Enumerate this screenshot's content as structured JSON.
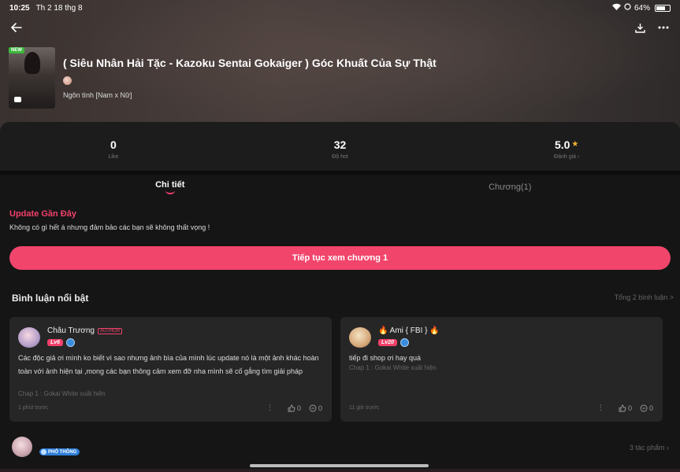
{
  "status_bar": {
    "time": "10:25",
    "date": "Th 2 18 thg 8",
    "battery": "64%"
  },
  "story": {
    "badge": "NEW",
    "title": "( Siêu Nhân Hải Tặc - Kazoku Sentai Gokaiger ) Góc Khuất Của Sự Thật",
    "genre": "Ngôn tình [Nam x Nữ]"
  },
  "stats": {
    "likes_value": "0",
    "likes_label": "Like",
    "hot_value": "32",
    "hot_label": "Độ hot",
    "rating_value": "5.0",
    "rating_label": "Đánh giá ›"
  },
  "tabs": {
    "detail": "Chi tiết",
    "chapters": "Chương(1)"
  },
  "update": {
    "title": "Update Gần Đây",
    "text": "Không có gì hết á nhưng đảm bảo các bạn sẽ không thất vọng !"
  },
  "continue_button": "Tiếp tục xem chương 1",
  "comments": {
    "header": "Bình luận nổi bật",
    "total": "Tổng 2 bình luận >",
    "items": [
      {
        "name": "Châu Trương",
        "author_tag": "AUTHOR",
        "level": "Lv6",
        "text": "Các độc giả ơi mình ko biết vì sao nhưng ảnh bìa của mình lúc update nó là một ảnh khác hoàn toàn với ảnh hiện tại ,mong các bạn thông cảm xem đỡ nha mình sẽ cố gắng tìm giải pháp",
        "chapter": "Chap 1 : Gokai White xuất hiện",
        "time": "1 phút trước",
        "likes": "0",
        "replies": "0"
      },
      {
        "name": "🔥 Ami { FBI } 🔥",
        "level": "Lv20",
        "text": "tiếp đi shop ơi hay quá",
        "chapter": "Chap 1 : Gokai White xuất hiện",
        "time": "11 giờ trước",
        "likes": "0",
        "replies": "0"
      }
    ]
  },
  "author_row": {
    "badge": "PHỔ THÔNG",
    "works": "3 tác phẩm ›"
  }
}
